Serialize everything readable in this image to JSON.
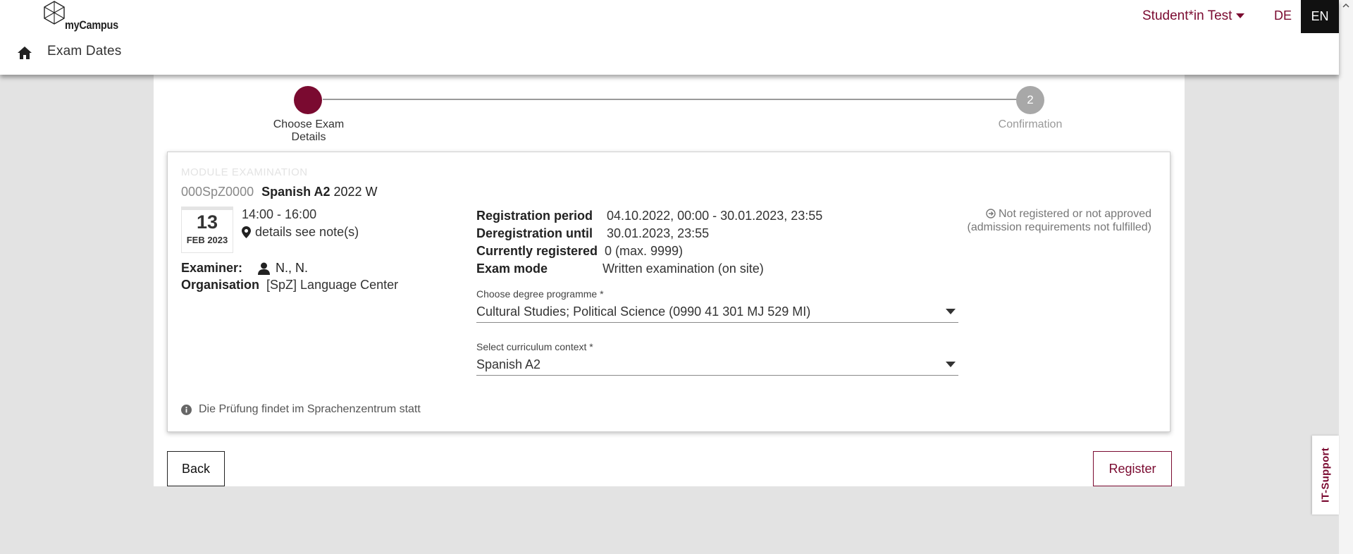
{
  "header": {
    "logo_text": "myCampus",
    "user_name": "Student*in Test",
    "lang_de": "DE",
    "lang_en": "EN",
    "breadcrumb": "Exam Dates"
  },
  "stepper": {
    "step1_label": "Choose Exam Details",
    "step2_number": "2",
    "step2_label": "Confirmation"
  },
  "exam": {
    "kicker": "MODULE EXAMINATION",
    "code": "000SpZ0000",
    "name": "Spanish A2",
    "term": "2022 W",
    "day": "13",
    "month_year": "FEB 2023",
    "time": "14:00 - 16:00",
    "location": "details see note(s)",
    "examiner_label": "Examiner:",
    "examiner": "N., N.",
    "organisation_label": "Organisation",
    "organisation": "[SpZ] Language Center",
    "registration": [
      {
        "label": "Registration period",
        "value": "04.10.2022, 00:00 - 30.01.2023, 23:55"
      },
      {
        "label": "Deregistration until",
        "value": "30.01.2023, 23:55"
      },
      {
        "label": "Currently registered",
        "value": "0 (max. 9999)"
      },
      {
        "label": "Exam mode",
        "value": "Written examination (on site)"
      }
    ],
    "status_line1": "Not registered or not approved",
    "status_line2": "(admission requirements not fulfilled)",
    "degree_label": "Choose degree programme *",
    "degree_value": "Cultural Studies; Political Science (0990 41 301 MJ 529 MI)",
    "curriculum_label": "Select curriculum context *",
    "curriculum_value": "Spanish A2",
    "note": "Die Prüfung findet im Sprachenzentrum statt"
  },
  "actions": {
    "back": "Back",
    "register": "Register"
  },
  "it_support": "IT-Support",
  "colors": {
    "accent": "#7a0a30",
    "step_inactive": "#a8a8a8",
    "page_bg": "#e3e3e3"
  }
}
